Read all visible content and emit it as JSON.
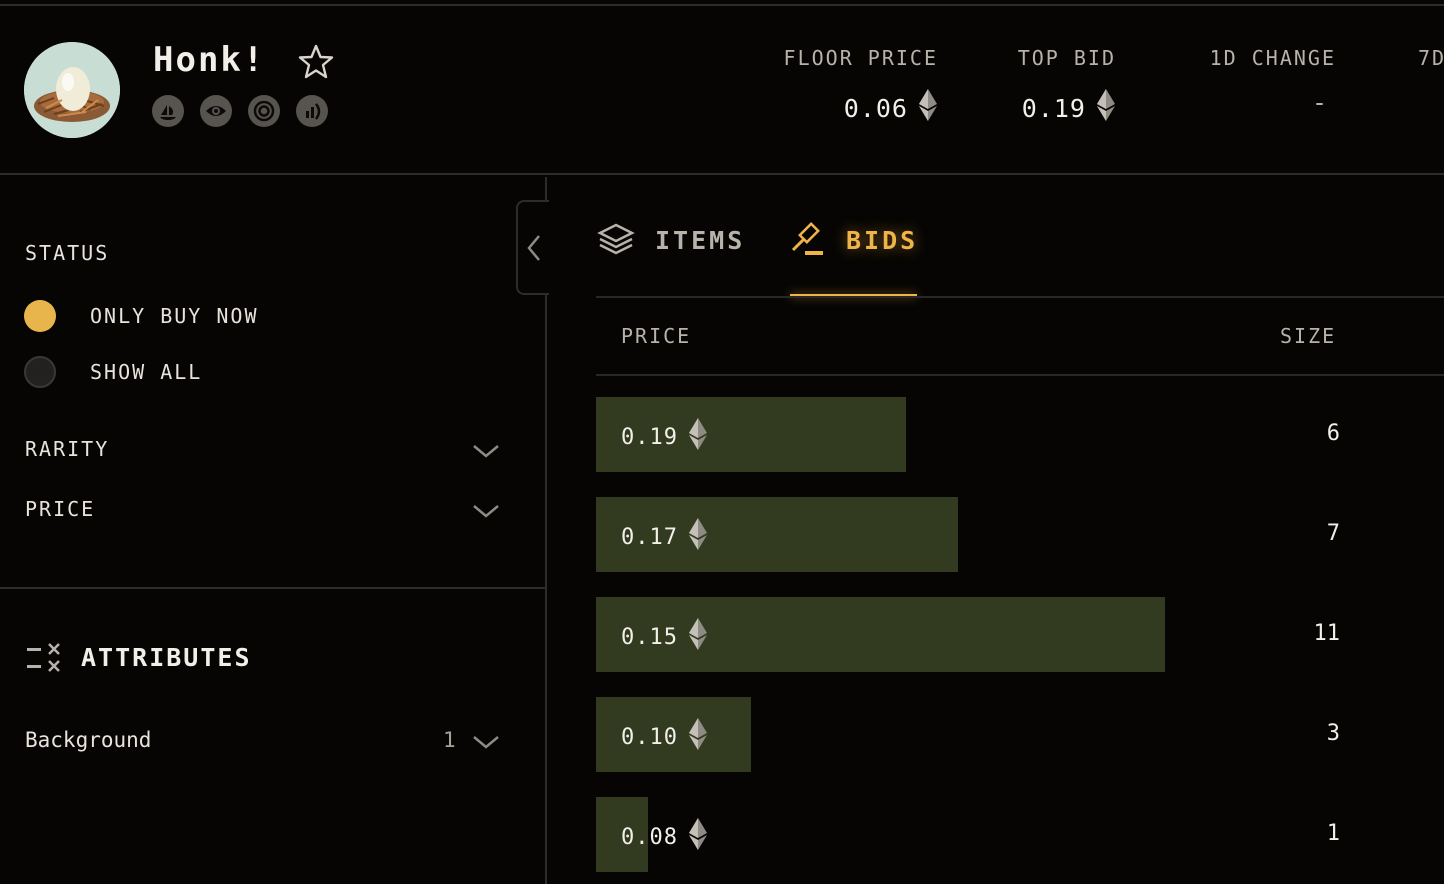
{
  "collection": {
    "name": "Honk!",
    "favorite_icon": "star-outline-icon",
    "social_icons": [
      "opensea-icon",
      "looksrare-icon",
      "x2y2-icon",
      "etherscan-icon"
    ]
  },
  "stats": [
    {
      "label": "FLOOR PRICE",
      "value": "0.06",
      "currency_icon": "eth-icon"
    },
    {
      "label": "TOP BID",
      "value": "0.19",
      "currency_icon": "eth-icon"
    },
    {
      "label": "1D CHANGE",
      "value": "-"
    },
    {
      "label": "7D"
    }
  ],
  "sidebar": {
    "status_title": "STATUS",
    "status_options": [
      {
        "label": "ONLY BUY NOW",
        "selected": true
      },
      {
        "label": "SHOW ALL",
        "selected": false
      }
    ],
    "filters": [
      {
        "label": "RARITY"
      },
      {
        "label": "PRICE"
      }
    ],
    "attributes_title": "ATTRIBUTES",
    "attributes": [
      {
        "label": "Background",
        "count": "1"
      }
    ]
  },
  "tabs": [
    {
      "label": "ITEMS",
      "icon": "layers-icon",
      "active": false
    },
    {
      "label": "BIDS",
      "icon": "gavel-icon",
      "active": true
    }
  ],
  "bids_table": {
    "headers": {
      "price": "PRICE",
      "size": "SIZE"
    },
    "rows": [
      {
        "price": "0.19",
        "size": "6"
      },
      {
        "price": "0.17",
        "size": "7"
      },
      {
        "price": "0.15",
        "size": "11"
      },
      {
        "price": "0.10",
        "size": "3"
      },
      {
        "price": "0.08",
        "size": "1"
      }
    ],
    "max_size": 11
  },
  "colors": {
    "accent": "#f0b348",
    "radio_selected": "#e8b54c",
    "depth_bar": "#323a20",
    "background": "#060504"
  }
}
